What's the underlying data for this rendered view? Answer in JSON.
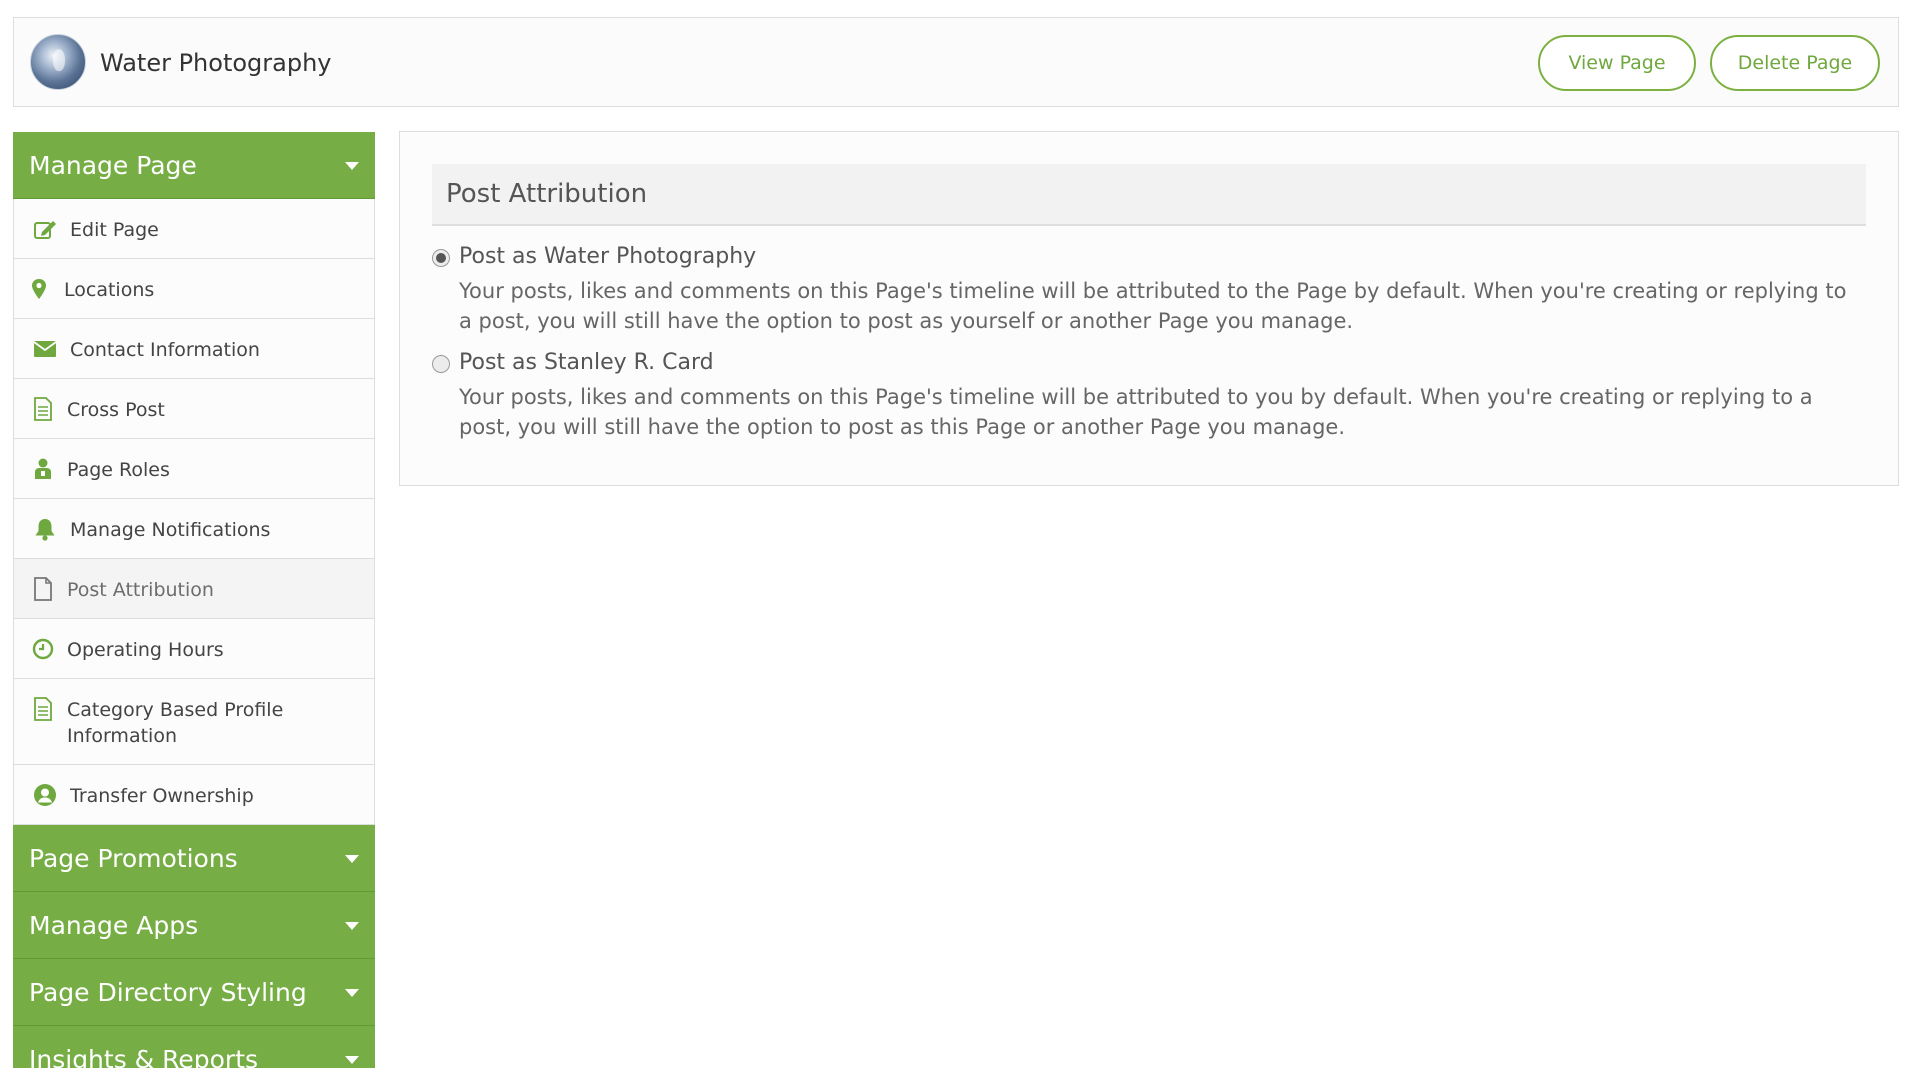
{
  "header": {
    "page_name": "Water Photography",
    "view_button": "View Page",
    "delete_button": "Delete Page"
  },
  "sidebar": {
    "manage_page": {
      "label": "Manage Page",
      "items": [
        {
          "label": "Edit Page",
          "icon": "edit-icon"
        },
        {
          "label": "Locations",
          "icon": "map-pin-icon"
        },
        {
          "label": "Contact Information",
          "icon": "envelope-icon"
        },
        {
          "label": "Cross Post",
          "icon": "document-icon"
        },
        {
          "label": "Page Roles",
          "icon": "user-roles-icon"
        },
        {
          "label": "Manage Notifications",
          "icon": "bell-icon"
        },
        {
          "label": "Post Attribution",
          "icon": "file-icon",
          "active": true
        },
        {
          "label": "Operating Hours",
          "icon": "clock-icon"
        },
        {
          "label": "Category Based Profile Information",
          "icon": "document-icon"
        },
        {
          "label": "Transfer Ownership",
          "icon": "user-circle-icon"
        }
      ]
    },
    "sections": [
      {
        "label": "Page Promotions"
      },
      {
        "label": "Manage Apps"
      },
      {
        "label": "Page Directory Styling"
      },
      {
        "label": "Insights & Reports"
      }
    ]
  },
  "main": {
    "title": "Post Attribution",
    "options": [
      {
        "title": "Post as Water Photography",
        "description": "Your posts, likes and comments on this Page's timeline will be attributed to the Page by default. When you're creating or replying to a post, you will still have the option to post as yourself or another Page you manage.",
        "checked": true
      },
      {
        "title": "Post as Stanley R. Card",
        "description": "Your posts, likes and comments on this Page's timeline will be attributed to you by default. When you're creating or replying to a post, you will still have the option to post as this Page or another Page you manage.",
        "checked": false
      }
    ]
  },
  "colors": {
    "accent": "#77ad45",
    "icon": "#6fa83e",
    "border": "#dddddd"
  }
}
